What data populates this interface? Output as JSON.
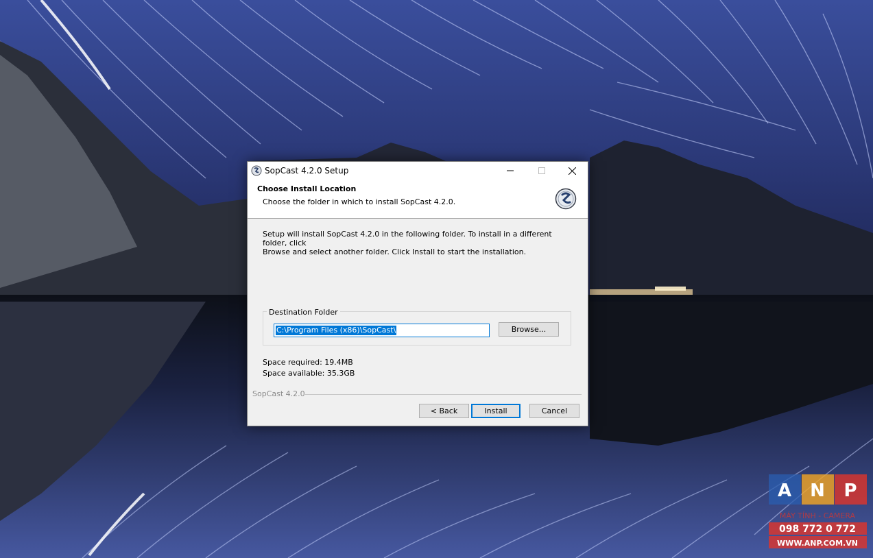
{
  "window": {
    "title": "SopCast 4.2.0 Setup"
  },
  "header": {
    "title": "Choose Install Location",
    "subtitle": "Choose the folder in which to install SopCast 4.2.0."
  },
  "body": {
    "intro_line1": "Setup will install SopCast 4.2.0 in the following folder. To install in a different folder, click",
    "intro_line2": "Browse and select another folder. Click Install to start the installation.",
    "destination_group_label": "Destination Folder",
    "destination_path": "C:\\Program Files (x86)\\SopCast\\",
    "browse_label": "Browse...",
    "space_required": "Space required: 19.4MB",
    "space_available": "Space available: 35.3GB"
  },
  "footer": {
    "branding": "SopCast 4.2.0",
    "back_label": "< Back",
    "install_label": "Install",
    "cancel_label": "Cancel"
  },
  "watermark": {
    "letters": [
      "A",
      "N",
      "P"
    ],
    "tagline": "MÁY TÍNH - CAMERA",
    "phone": "098 772 0 772",
    "site": "WWW.ANP.COM.VN",
    "colors": [
      "#2a5db0",
      "#f5a623",
      "#e0342b"
    ]
  },
  "icons": {
    "app": "sopcast-icon",
    "minimize": "minimize-icon",
    "maximize": "maximize-icon",
    "close": "close-icon"
  },
  "colors": {
    "accent": "#0078d7",
    "dialog_bg": "#f0f0f0",
    "header_bg": "#ffffff"
  }
}
